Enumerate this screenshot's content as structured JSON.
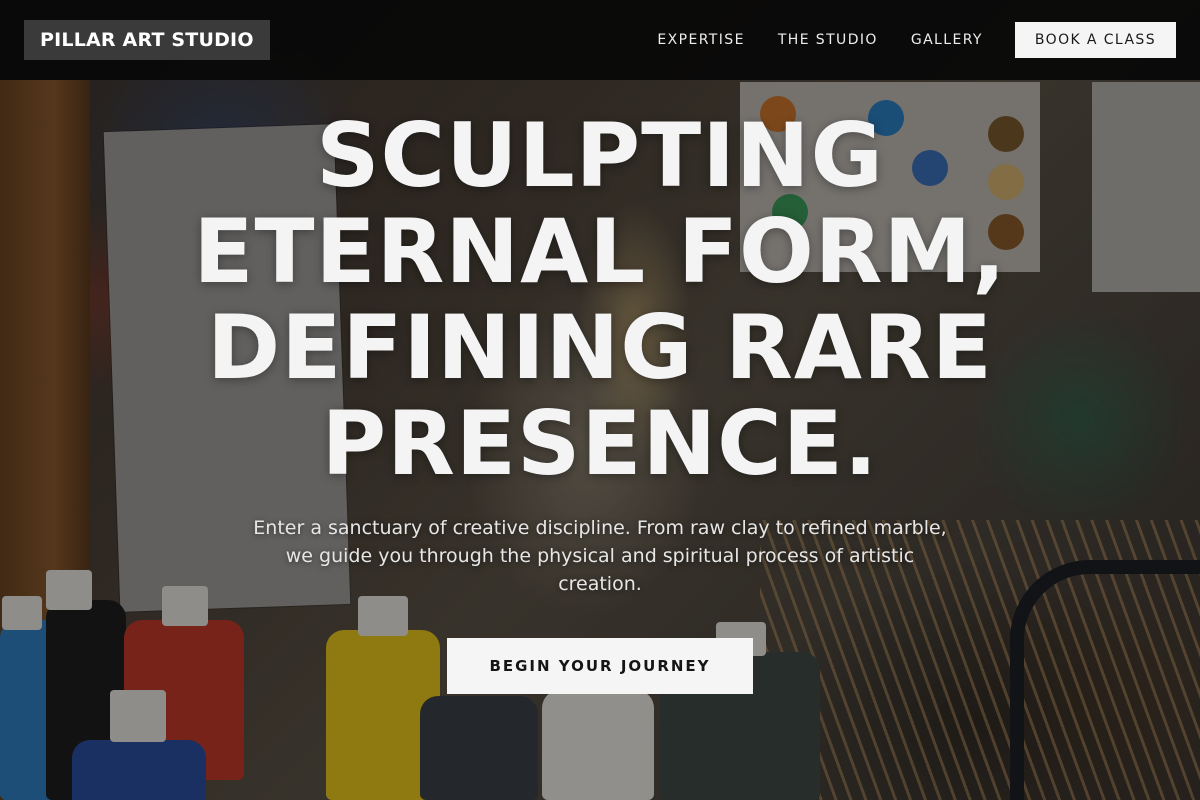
{
  "brand": {
    "name": "PILLAR ART STUDIO"
  },
  "nav": {
    "links": [
      "EXPERTISE",
      "THE STUDIO",
      "GALLERY"
    ],
    "cta": "BOOK A CLASS"
  },
  "hero": {
    "headline_lines": [
      "SCULPTING",
      "ETERNAL FORM,",
      "DEFINING RARE",
      "PRESENCE."
    ],
    "subtext": "Enter a sanctuary of creative discipline. From raw clay to refined marble, we guide you through the physical and spiritual process of artistic creation.",
    "cta": "BEGIN YOUR JOURNEY",
    "background_image": "art-studio-photo"
  },
  "colors": {
    "nav_bg": "#080808",
    "brand_bg": "#3a3a3a",
    "button_bg": "#f5f5f5",
    "text_light": "#f4f4f4"
  }
}
